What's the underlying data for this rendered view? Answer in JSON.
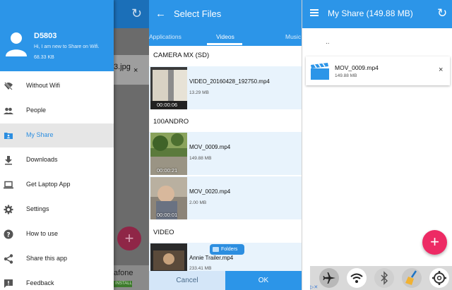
{
  "drawer": {
    "user_name": "D5803",
    "user_status": "Hi, I am new to Share on Wifi.",
    "user_size": "68.33 KB",
    "items": [
      {
        "label": "Without Wifi",
        "icon": "wifi-off-icon"
      },
      {
        "label": "People",
        "icon": "people-icon"
      },
      {
        "label": "My Share",
        "icon": "my-share-icon",
        "active": true
      },
      {
        "label": "Downloads",
        "icon": "download-icon"
      },
      {
        "label": "Get Laptop App",
        "icon": "laptop-icon"
      },
      {
        "label": "Settings",
        "icon": "gear-icon"
      },
      {
        "label": "How to use",
        "icon": "help-icon"
      },
      {
        "label": "Share this app",
        "icon": "share-icon"
      },
      {
        "label": "Feedback",
        "icon": "feedback-icon"
      }
    ],
    "background": {
      "file_snippet": "3.jpg",
      "close_glyph": "×",
      "fab_glyph": "+",
      "ad_text": "afone",
      "install_badge": "INSTALL"
    }
  },
  "select_files": {
    "title": "Select Files",
    "back_glyph": "←",
    "tabs": [
      "Applications",
      "Videos",
      "Music"
    ],
    "active_tab": "Videos",
    "sections": [
      {
        "header": "CAMERA MX (SD)",
        "files": [
          {
            "name": "VIDEO_20160428_192750.mp4",
            "size": "13.29 MB",
            "duration": "00:00:06"
          }
        ]
      },
      {
        "header": "100ANDRO",
        "files": [
          {
            "name": "MOV_0009.mp4",
            "size": "149.88 MB",
            "duration": "00:00:21"
          },
          {
            "name": "MOV_0020.mp4",
            "size": "2.00 MB",
            "duration": "00:00:01"
          }
        ]
      },
      {
        "header": "VIDEO",
        "files": [
          {
            "name": "Annie Trailer.mp4",
            "size": "233.41 MB",
            "duration": ""
          }
        ]
      }
    ],
    "folders_label": "Folders",
    "cancel_label": "Cancel",
    "ok_label": "OK"
  },
  "my_share": {
    "title": "My Share (149.88 MB)",
    "refresh_glyph": "↻",
    "parent_dir": "..",
    "item": {
      "name": "MOV_0009.mp4",
      "size": "149.88 MB",
      "close_glyph": "×"
    },
    "fab_glyph": "+",
    "ad_icons": [
      "airplane-mode-icon",
      "wifi-icon",
      "bluetooth-icon",
      "cleaner-broom-icon",
      "settings-gear-icon"
    ]
  },
  "colors": {
    "primary": "#2c95e8",
    "accent": "#ed2a64",
    "selected_row": "#e8f3fc"
  }
}
